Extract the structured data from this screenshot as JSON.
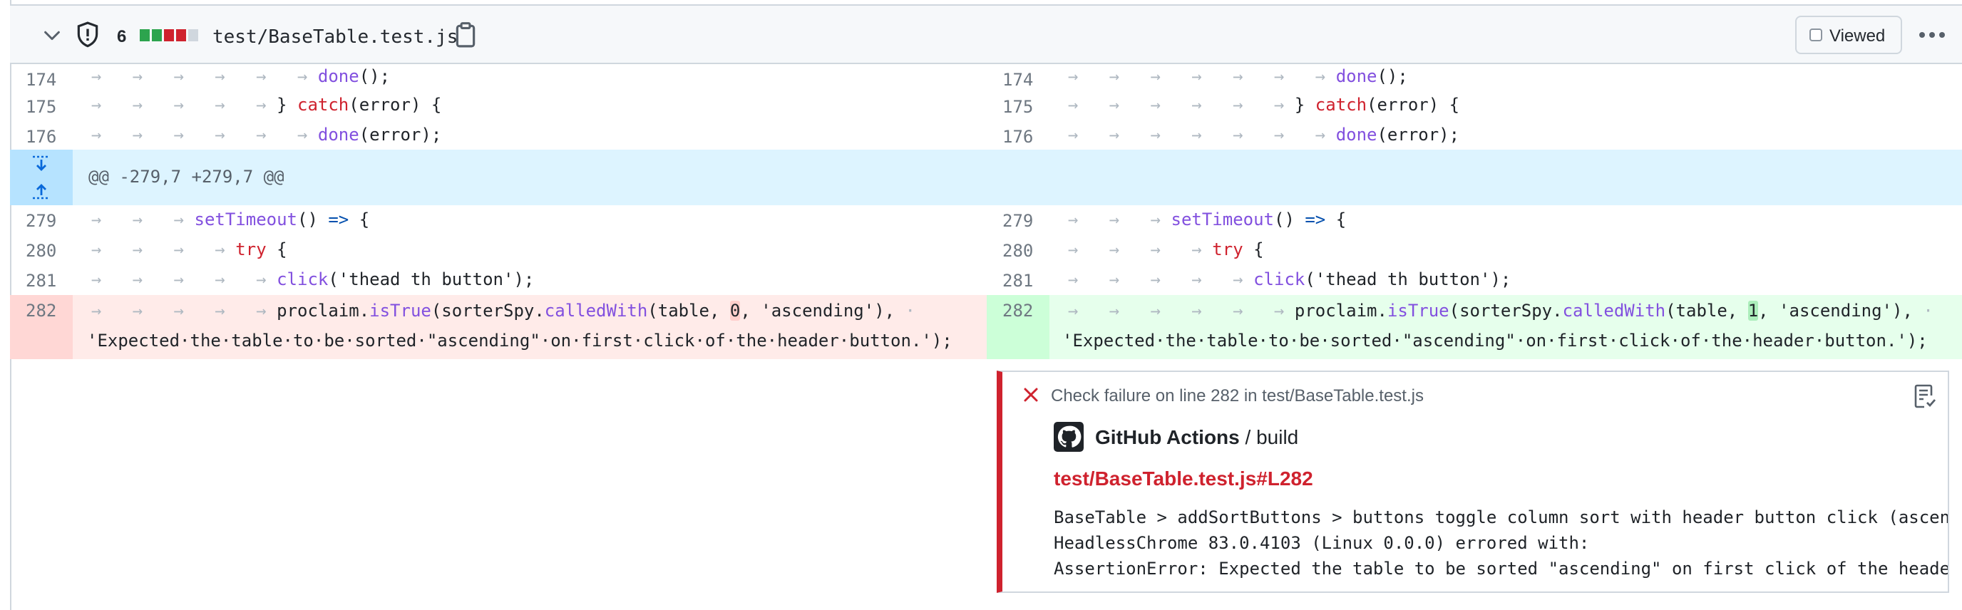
{
  "header": {
    "change_count": "6",
    "diffstat": [
      "#2da44e",
      "#2da44e",
      "#cf222e",
      "#cf222e",
      "#d0d7de"
    ],
    "file_path": "test/BaseTable.test.js",
    "viewed_label": "Viewed",
    "icons": [
      "chevron-down-icon",
      "shield-icon",
      "copy-icon",
      "kebab-icon"
    ]
  },
  "hunk": {
    "header": "@@ -279,7 +279,7 @@"
  },
  "rows": {
    "r174": {
      "ln": "174"
    },
    "r175": {
      "ln": "175"
    },
    "r176": {
      "ln": "176"
    },
    "r279": {
      "ln": "279"
    },
    "r280": {
      "ln": "280"
    },
    "r281": {
      "ln": "281"
    },
    "r282": {
      "ln": "282"
    }
  },
  "tokens": {
    "done": "done",
    "paren_semi": "();",
    "close_brace": "}",
    "catch": "catch",
    "error_open": "(error)",
    "brace": "{",
    "done_error": "(error);",
    "setTimeout": "setTimeout",
    "parens": "()",
    "arrow": "=>",
    "try": "try",
    "click": "click",
    "click_arg": "('thead",
    "th": "th",
    "button_close": "button');",
    "proclaim": "proclaim.",
    "isTrue": "isTrue",
    "sorter": "(sorterSpy.",
    "calledWith": "calledWith",
    "table": "(table,",
    "old_value": "0",
    "new_value": "1",
    "comma": ",",
    "ascending": "'ascending'),",
    "wrap_line": "'Expected·the·table·to·be·sorted·\"ascending\"·on·first·click·of·the·header·button.');"
  },
  "annotation": {
    "title": "Check failure on line 282 in test/BaseTable.test.js",
    "source_app": "GitHub Actions",
    "source_job": " / build",
    "link": "test/BaseTable.test.js#L282",
    "message": [
      "BaseTable > addSortButtons > buttons toggle column sort with header button click (ascending)",
      "HeadlessChrome 83.0.4103 (Linux 0.0.0) errored with:",
      "AssertionError: Expected the table to be sorted \"ascending\" on first click of the header button."
    ],
    "icons": [
      "x-icon",
      "github-logo-icon",
      "checklist-icon"
    ]
  }
}
